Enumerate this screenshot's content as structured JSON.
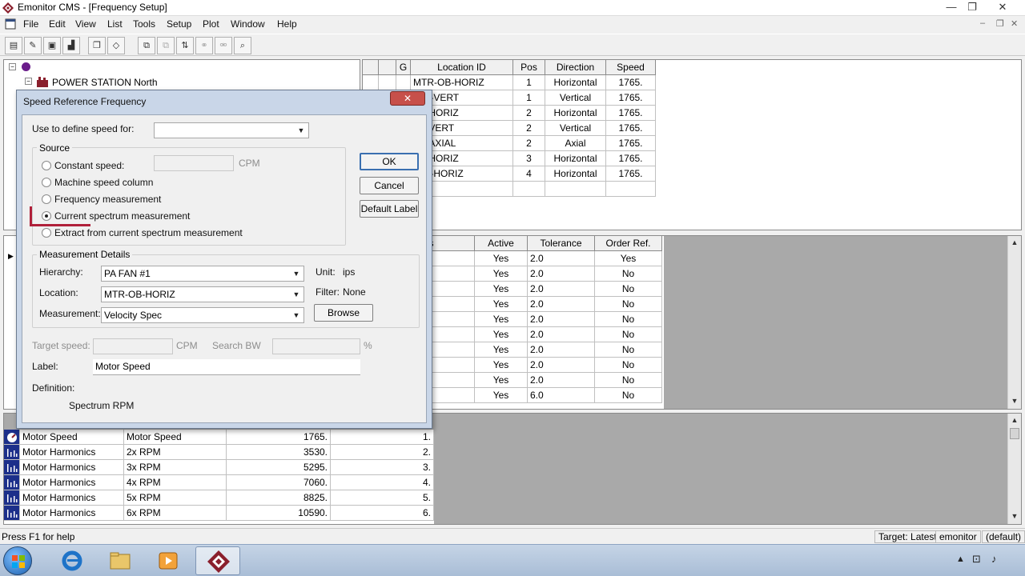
{
  "window": {
    "title": "Emonitor CMS - [Frequency Setup]",
    "controls": {
      "minimize": "—",
      "restore": "❐",
      "close": "✕"
    },
    "mdi_controls": {
      "minimize": "–",
      "restore": "❐",
      "close": "✕"
    }
  },
  "menu": [
    "File",
    "Edit",
    "View",
    "List",
    "Tools",
    "Setup",
    "Plot",
    "Window",
    "Help"
  ],
  "tree": {
    "root_label": "",
    "site_label": "POWER STATION North"
  },
  "locations_grid": {
    "headers": [
      "",
      "",
      "G",
      "Location ID",
      "Pos",
      "Direction",
      "Speed"
    ],
    "rows": [
      {
        "id": "MTR-OB-HORIZ",
        "pos": "1",
        "direction": "Horizontal",
        "speed": "1765."
      },
      {
        "id": "-OB-VERT",
        "pos": "1",
        "direction": "Vertical",
        "speed": "1765."
      },
      {
        "id": "-IB-HORIZ",
        "pos": "2",
        "direction": "Horizontal",
        "speed": "1765."
      },
      {
        "id": "-IB-VERT",
        "pos": "2",
        "direction": "Vertical",
        "speed": "1765."
      },
      {
        "id": "-IB-AXIAL",
        "pos": "2",
        "direction": "Axial",
        "speed": "1765."
      },
      {
        "id": "-IB-HORIZ",
        "pos": "3",
        "direction": "Horizontal",
        "speed": "1765."
      },
      {
        "id": "-OB-HORIZ",
        "pos": "4",
        "direction": "Horizontal",
        "speed": "1765."
      }
    ]
  },
  "frequency_grid": {
    "headers": [
      "cations",
      "Active",
      "Tolerance",
      "Order Ref."
    ],
    "rows": [
      {
        "active": "Yes",
        "tolerance": "2.0",
        "order_ref": "Yes"
      },
      {
        "active": "Yes",
        "tolerance": "2.0",
        "order_ref": "No"
      },
      {
        "active": "Yes",
        "tolerance": "2.0",
        "order_ref": "No"
      },
      {
        "active": "Yes",
        "tolerance": "2.0",
        "order_ref": "No"
      },
      {
        "active": "Yes",
        "tolerance": "2.0",
        "order_ref": "No"
      },
      {
        "active": "Yes",
        "tolerance": "2.0",
        "order_ref": "No"
      },
      {
        "active": "Yes",
        "tolerance": "2.0",
        "order_ref": "No"
      },
      {
        "active": "Yes",
        "tolerance": "2.0",
        "order_ref": "No"
      },
      {
        "active": "Yes",
        "tolerance": "2.0",
        "order_ref": "No"
      },
      {
        "active": "Yes",
        "tolerance": "6.0",
        "order_ref": "No"
      }
    ]
  },
  "speed_refs": {
    "rows": [
      {
        "name": "Motor Speed",
        "label": "Motor Speed",
        "value": "1765.",
        "order": "1.",
        "icon": "speed-gauge-icon"
      },
      {
        "name": "Motor Harmonics",
        "label": "2x RPM",
        "value": "3530.",
        "order": "2.",
        "icon": "spectrum-icon"
      },
      {
        "name": "Motor Harmonics",
        "label": "3x RPM",
        "value": "5295.",
        "order": "3.",
        "icon": "spectrum-icon"
      },
      {
        "name": "Motor Harmonics",
        "label": "4x RPM",
        "value": "7060.",
        "order": "4.",
        "icon": "spectrum-icon"
      },
      {
        "name": "Motor Harmonics",
        "label": "5x RPM",
        "value": "8825.",
        "order": "5.",
        "icon": "spectrum-icon"
      },
      {
        "name": "Motor Harmonics",
        "label": "6x RPM",
        "value": "10590.",
        "order": "6.",
        "icon": "spectrum-icon"
      }
    ]
  },
  "dialog": {
    "title": "Speed Reference Frequency",
    "close_label": "✕",
    "use_to_define_label": "Use to define speed for:",
    "use_to_define_value": "",
    "source_group": "Source",
    "sources": [
      {
        "label": "Constant speed:",
        "selected": false
      },
      {
        "label": "Machine speed column",
        "selected": false
      },
      {
        "label": "Frequency measurement",
        "selected": false
      },
      {
        "label": "Current spectrum measurement",
        "selected": true
      },
      {
        "label": "Extract from current spectrum measurement",
        "selected": false
      }
    ],
    "constant_speed_value": "",
    "constant_speed_unit": "CPM",
    "ok_label": "OK",
    "cancel_label": "Cancel",
    "default_label_button": "Default Label",
    "measurement_group": "Measurement Details",
    "hierarchy_label": "Hierarchy:",
    "hierarchy_value": "PA FAN #1",
    "location_label": "Location:",
    "location_value": "MTR-OB-HORIZ",
    "measurement_label": "Measurement:",
    "measurement_value": "Velocity Spec",
    "unit_label": "Unit:",
    "unit_value": "ips",
    "filter_label": "Filter:",
    "filter_value": "None",
    "browse_label": "Browse",
    "target_speed_label": "Target speed:",
    "target_speed_unit": "CPM",
    "search_bw_label": "Search BW",
    "search_bw_unit": "%",
    "label_label": "Label:",
    "label_value": "Motor Speed",
    "definition_label": "Definition:",
    "definition_value": "Spectrum RPM"
  },
  "statusbar": {
    "help": "Press F1 for help",
    "target": "Target: Latest",
    "user": "emonitor",
    "profile": "(default)"
  },
  "colors": {
    "dialog_frame": "#c9d6e8",
    "close_red": "#c7504a",
    "annotation": "#b0203a"
  }
}
